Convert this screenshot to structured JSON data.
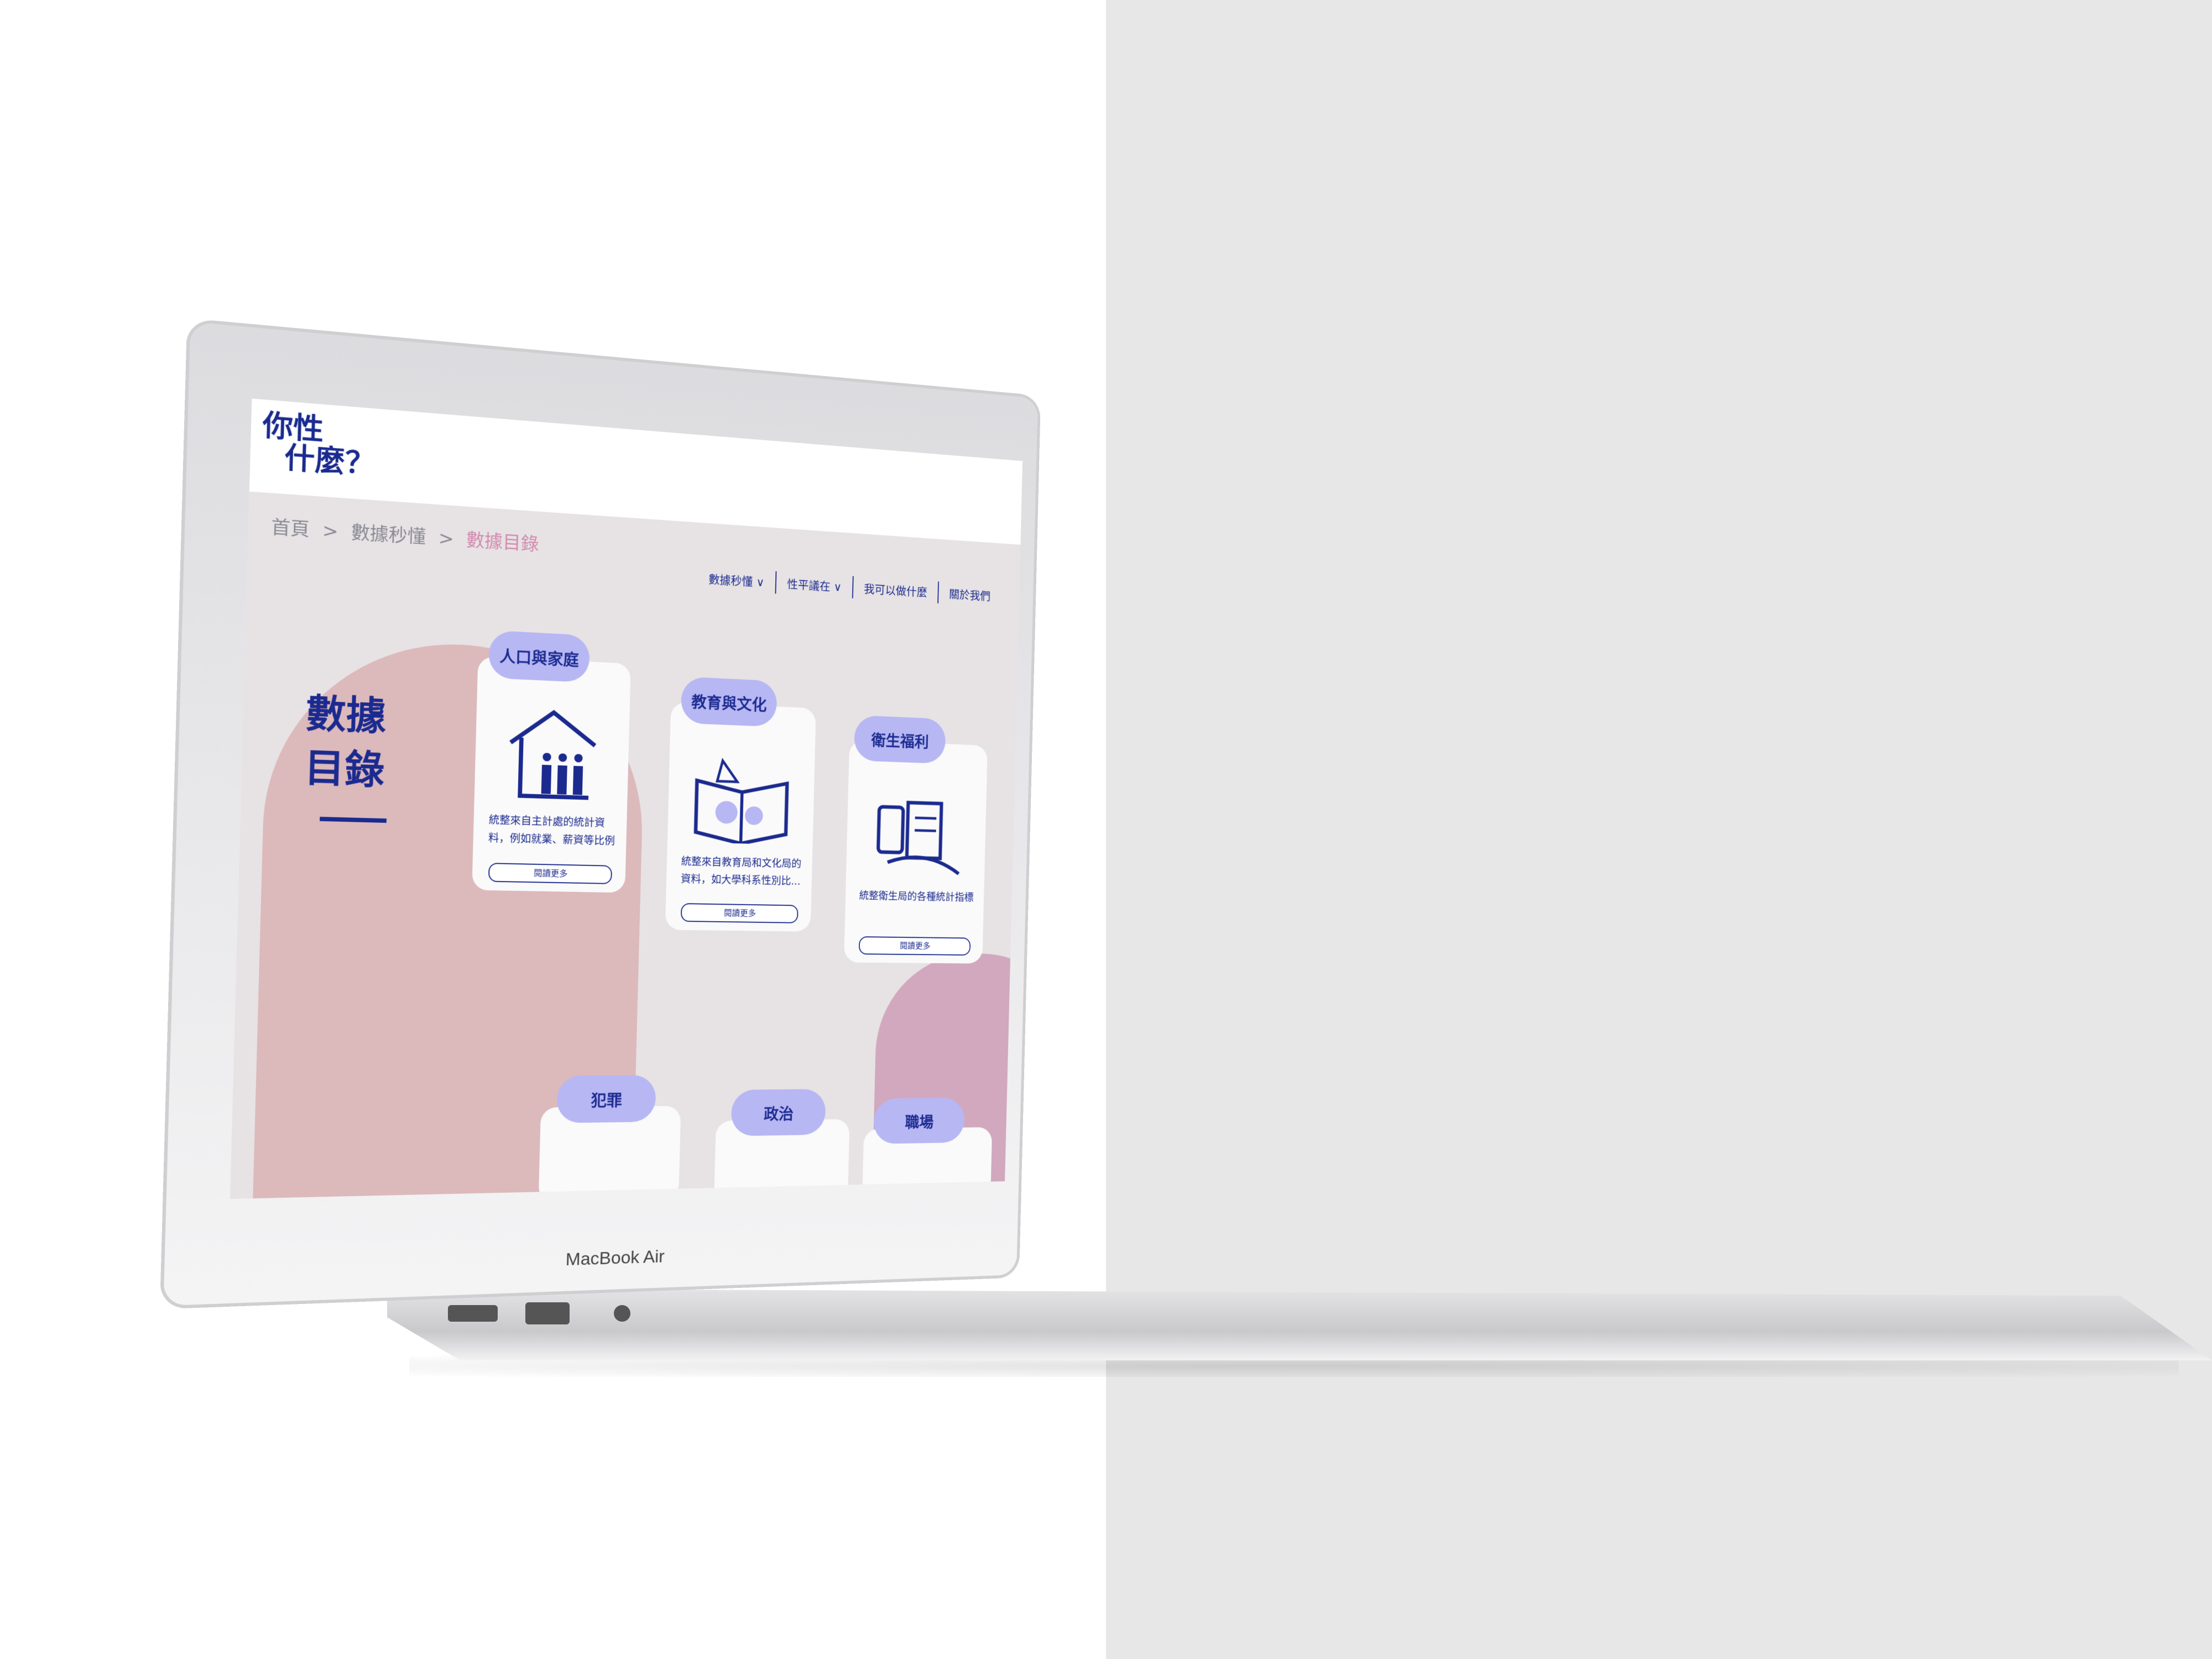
{
  "device": {
    "brand_label": "MacBook Air"
  },
  "site": {
    "logo_line1": "你性",
    "logo_line2": "什麼？",
    "breadcrumb": {
      "home": "首頁",
      "section": "數據秒懂",
      "current": "數據目錄",
      "separator": ">"
    },
    "nav": [
      {
        "label": "數據秒懂 ∨"
      },
      {
        "label": "性平議在 ∨"
      },
      {
        "label": "我可以做什麼"
      },
      {
        "label": "關於我們"
      }
    ],
    "page_title_line1": "數據",
    "page_title_line2": "目錄"
  },
  "cards": [
    {
      "tag": "人口與家庭",
      "icon": "house-people-icon",
      "desc": "統整來自主計處的統計資料，例如就業、薪資等比例",
      "button": "閱讀更多"
    },
    {
      "tag": "教育與文化",
      "icon": "open-book-icon",
      "desc": "統整來自教育局和文化局的資料，如大學科系性別比...",
      "button": "閱讀更多"
    },
    {
      "tag": "衛生福利",
      "icon": "medical-records-icon",
      "desc": "統整衛生局的各種統計指標",
      "button": "閱讀更多"
    }
  ],
  "lower_cards": [
    {
      "tag": "犯罪"
    },
    {
      "tag": "政治"
    },
    {
      "tag": "職場"
    }
  ],
  "colors": {
    "brand": "#1b2a8f",
    "tag": "#b7b7f4",
    "pink": "#dcb9bb",
    "crumb_current": "#d28ab0"
  }
}
